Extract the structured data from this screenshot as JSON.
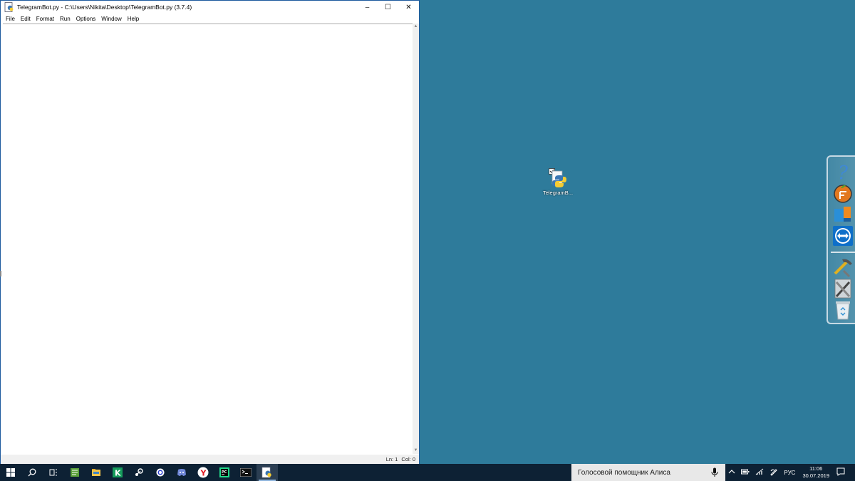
{
  "window": {
    "title": "TelegramBot.py - C:\\Users\\Nikita\\Desktop\\TelegramBot.py (3.7.4)",
    "controls": {
      "minimize": "–",
      "maximize": "☐",
      "close": "✕"
    }
  },
  "menu": [
    "File",
    "Edit",
    "Format",
    "Run",
    "Options",
    "Window",
    "Help"
  ],
  "status": {
    "line": "Ln: 1",
    "col": "Col: 0"
  },
  "desktop_icon": {
    "label": "TelegramB...",
    "icon": "python-file-icon"
  },
  "dock": {
    "items": [
      "help-icon",
      "fl-studio-icon",
      "app-icon",
      "teamviewer-icon",
      "tools-icon",
      "ruler-tools-icon",
      "recycle-bin-icon"
    ]
  },
  "taskbar": {
    "apps": [
      "start-icon",
      "search-icon",
      "task-view-icon",
      "notepad-icon",
      "file-explorer-icon",
      "kaspersky-icon",
      "steam-icon",
      "cortana-ring-icon",
      "discord-icon",
      "yandex-icon",
      "pycharm-icon",
      "terminal-icon",
      "python-idle-icon"
    ],
    "search_text": "Голосовой помощник Алиса",
    "language": "РУС",
    "time": "11:06",
    "date": "30.07.2019"
  },
  "colors": {
    "desktop": "#2e7b9b",
    "taskbar": "#0d2134"
  }
}
